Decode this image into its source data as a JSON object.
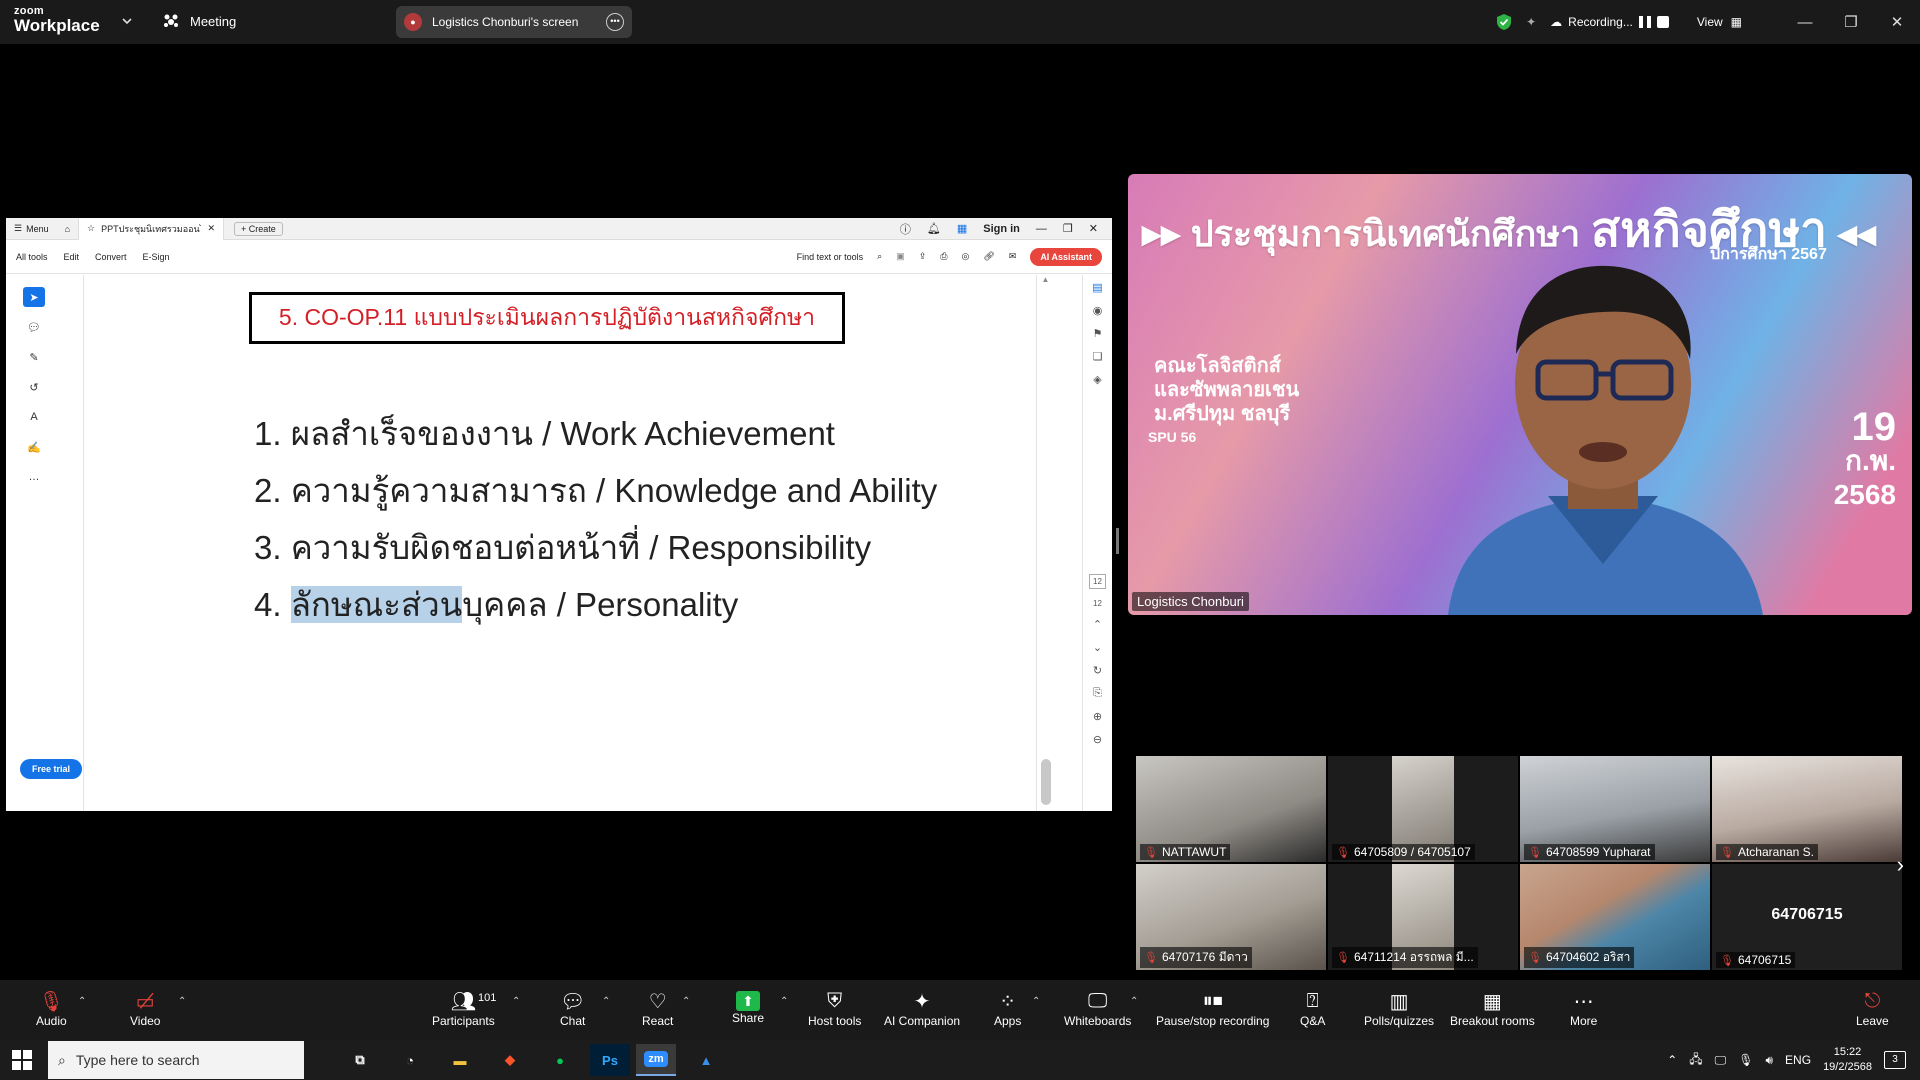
{
  "app": {
    "logo_line1": "zoom",
    "logo_line2": "Workplace",
    "meeting_label": "Meeting",
    "screen_title": "Logistics Chonburi's screen",
    "recording_label": "Recording...",
    "view_label": "View"
  },
  "acrobat": {
    "menu_label": "Menu",
    "tab_title": "PPTประชุมนิเทศรวมออนไลน์...",
    "create_label": "Create",
    "sign_in": "Sign in",
    "tools": [
      "All tools",
      "Edit",
      "Convert",
      "E-Sign"
    ],
    "find_label": "Find text or tools",
    "ai_label": "AI Assistant",
    "free_trial": "Free trial",
    "page_current": "12",
    "page_total": "12"
  },
  "slide": {
    "title": "5. CO-OP.11 แบบประเมินผลการปฏิบัติงานสหกิจศึกษา",
    "items": [
      "1. ผลสำเร็จของงาน / Work Achievement",
      "2. ความรู้ความสามารถ / Knowledge and Ability",
      "3. ความรับผิดชอบต่อหน้าที่ / Responsibility"
    ],
    "item4_prefix": "4. ",
    "item4_highlight": "ลักษณะส่วน",
    "item4_rest": "บุคคล / Personality"
  },
  "speaker": {
    "banner_small": "ประชุมการนิเทศนักศึกษา",
    "banner_big": "สหกิจศึกษา",
    "year": "ปีการศึกษา 2567",
    "faculty_line1": "คณะโลจิสติกส์",
    "faculty_line2": "และซัพพลายเชน",
    "faculty_line3": "ม.ศรีปทุม ชลบุรี",
    "spu": "SPU 56",
    "date_day": "19",
    "date_month": "ก.พ.",
    "date_year": "2568",
    "name": "Logistics Chonburi"
  },
  "gallery": [
    {
      "name": "NATTAWUT"
    },
    {
      "name": "64705809 / 64705107"
    },
    {
      "name": "64708599 Yupharat"
    },
    {
      "name": "Atcharanan S."
    },
    {
      "name": "64707176 มีดาว"
    },
    {
      "name": "64711214 อรรถพล มี..."
    },
    {
      "name": "64704602 อริสา"
    },
    {
      "name": "64706715",
      "center": "64706715"
    }
  ],
  "toolbar": {
    "audio": "Audio",
    "video": "Video",
    "participants": "Participants",
    "participants_count": "101",
    "chat": "Chat",
    "react": "React",
    "share": "Share",
    "host_tools": "Host tools",
    "ai_companion": "AI Companion",
    "apps": "Apps",
    "whiteboards": "Whiteboards",
    "pause_recording": "Pause/stop recording",
    "qa": "Q&A",
    "polls": "Polls/quizzes",
    "breakout": "Breakout rooms",
    "more": "More",
    "leave": "Leave"
  },
  "taskbar": {
    "search_placeholder": "Type here to search",
    "lang": "ENG",
    "time": "15:22",
    "date": "19/2/2568",
    "notifications": "3"
  }
}
